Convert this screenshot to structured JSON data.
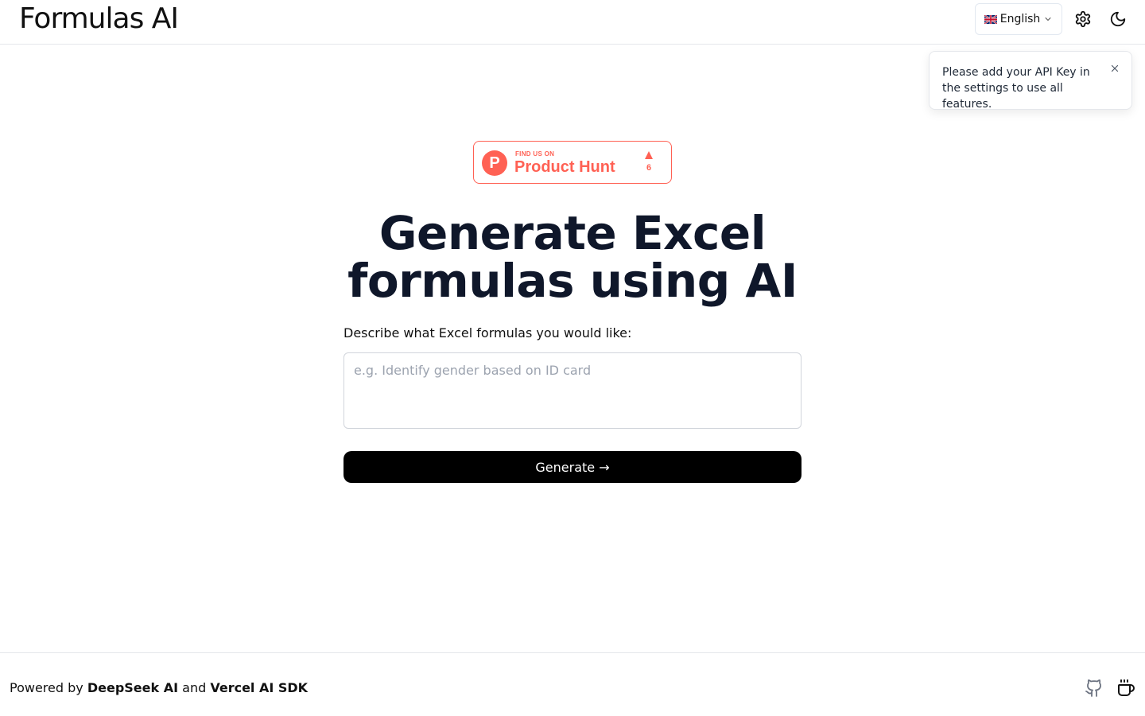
{
  "header": {
    "brand": "Formulas AI",
    "language": {
      "selected": "English",
      "flag_icon": "uk-flag-icon"
    },
    "settings_icon": "gear-icon",
    "theme_icon": "moon-icon"
  },
  "toast": {
    "message": "Please add your API Key in the settings to use all features.",
    "close_icon": "close-icon"
  },
  "product_hunt": {
    "tagline": "FIND US ON",
    "name": "Product Hunt",
    "logo_letter": "P",
    "votes": "6",
    "accent": "#ff6154"
  },
  "hero": {
    "title": "Generate Excel formulas using AI"
  },
  "form": {
    "label": "Describe what Excel formulas you would like:",
    "placeholder": "e.g. Identify gender based on ID card",
    "value": "",
    "submit_label": "Generate →"
  },
  "footer": {
    "prefix": "Powered by ",
    "link1": "DeepSeek AI",
    "middle": " and ",
    "link2": "Vercel AI SDK",
    "github_icon": "github-icon",
    "coffee_icon": "coffee-icon"
  }
}
